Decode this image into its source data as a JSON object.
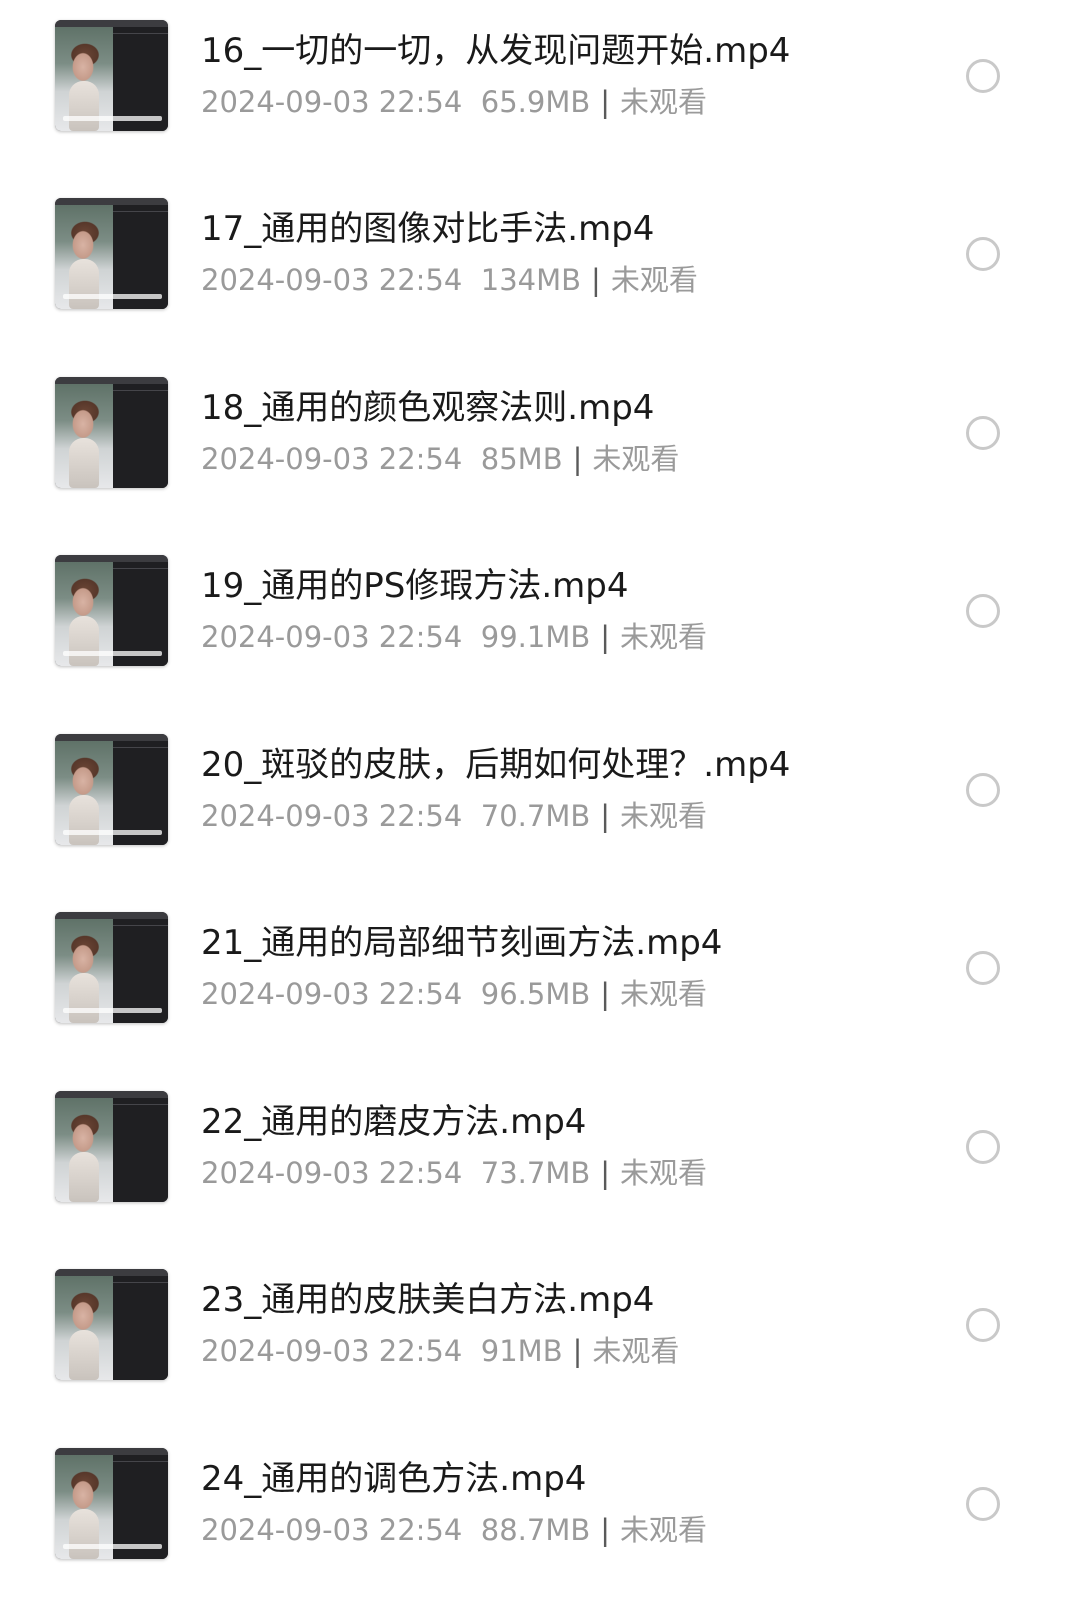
{
  "files": [
    {
      "name": "16_一切的一切，从发现问题开始.mp4",
      "date": "2024-09-03 22:54",
      "size": "65.9MB",
      "separator": "|",
      "status": "未观看",
      "selected": false
    },
    {
      "name": "17_通用的图像对比手法.mp4",
      "date": "2024-09-03 22:54",
      "size": "134MB",
      "separator": "|",
      "status": "未观看",
      "selected": false
    },
    {
      "name": "18_通用的颜色观察法则.mp4",
      "date": "2024-09-03 22:54",
      "size": "85MB",
      "separator": "|",
      "status": "未观看",
      "selected": false
    },
    {
      "name": "19_通用的PS修瑕方法.mp4",
      "date": "2024-09-03 22:54",
      "size": "99.1MB",
      "separator": "|",
      "status": "未观看",
      "selected": false
    },
    {
      "name": "20_斑驳的皮肤，后期如何处理？.mp4",
      "date": "2024-09-03 22:54",
      "size": "70.7MB",
      "separator": "|",
      "status": "未观看",
      "selected": false
    },
    {
      "name": "21_通用的局部细节刻画方法.mp4",
      "date": "2024-09-03 22:54",
      "size": "96.5MB",
      "separator": "|",
      "status": "未观看",
      "selected": false
    },
    {
      "name": "22_通用的磨皮方法.mp4",
      "date": "2024-09-03 22:54",
      "size": "73.7MB",
      "separator": "|",
      "status": "未观看",
      "selected": false
    },
    {
      "name": "23_通用的皮肤美白方法.mp4",
      "date": "2024-09-03 22:54",
      "size": "91MB",
      "separator": "|",
      "status": "未观看",
      "selected": false
    },
    {
      "name": "24_通用的调色方法.mp4",
      "date": "2024-09-03 22:54",
      "size": "88.7MB",
      "separator": "|",
      "status": "未观看",
      "selected": false
    }
  ],
  "thumbnail_icon": "video-thumbnail",
  "select_icon": "radio-circle-icon",
  "colors": {
    "title": "#1a1a1a",
    "meta": "#9a9a9a",
    "circle": "#c9c9c9"
  }
}
